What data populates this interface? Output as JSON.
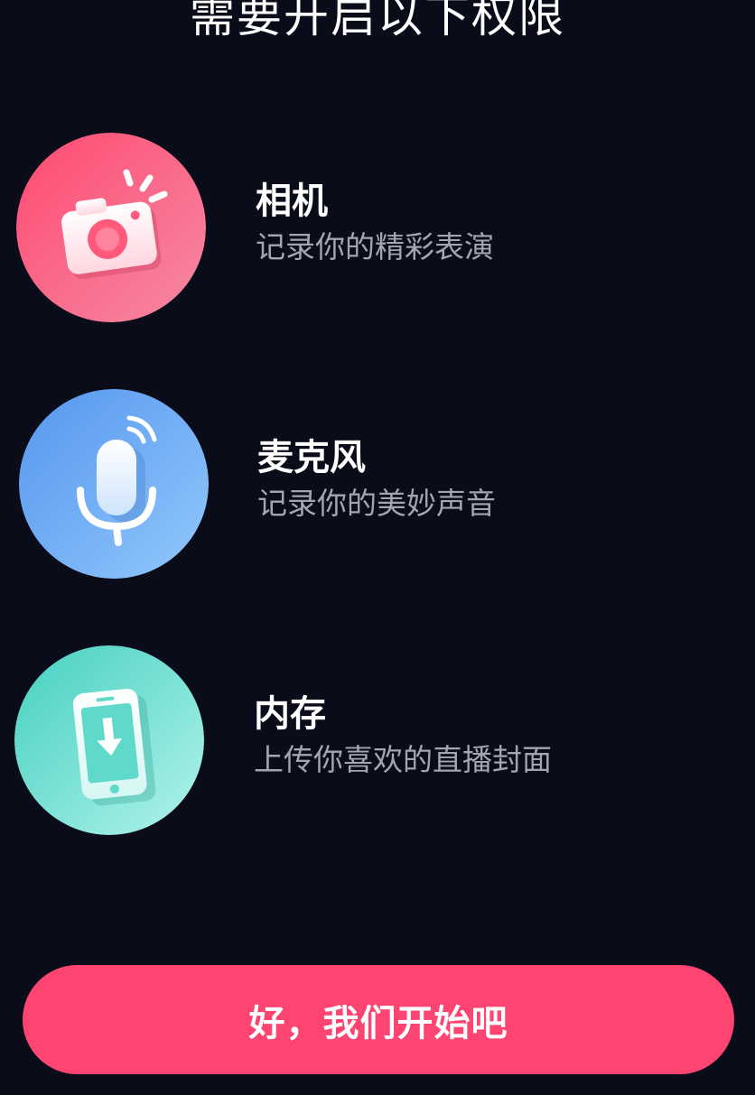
{
  "title": "需要开启以下权限",
  "permissions": [
    {
      "title": "相机",
      "description": "记录你的精彩表演",
      "icon": "camera-icon",
      "color_from": "#ff4f74",
      "color_to": "#f37a98"
    },
    {
      "title": "麦克风",
      "description": "记录你的美妙声音",
      "icon": "microphone-icon",
      "color_from": "#5a9cf0",
      "color_to": "#8cc2fb"
    },
    {
      "title": "内存",
      "description": "上传你喜欢的直播封面",
      "icon": "phone-download-icon",
      "color_from": "#4dd4c5",
      "color_to": "#a3f0e6"
    }
  ],
  "confirm_button": "好，我们开始吧",
  "colors": {
    "background": "#0a0c1a",
    "accent": "#fe4470",
    "description_text": "#a3a5b1"
  }
}
